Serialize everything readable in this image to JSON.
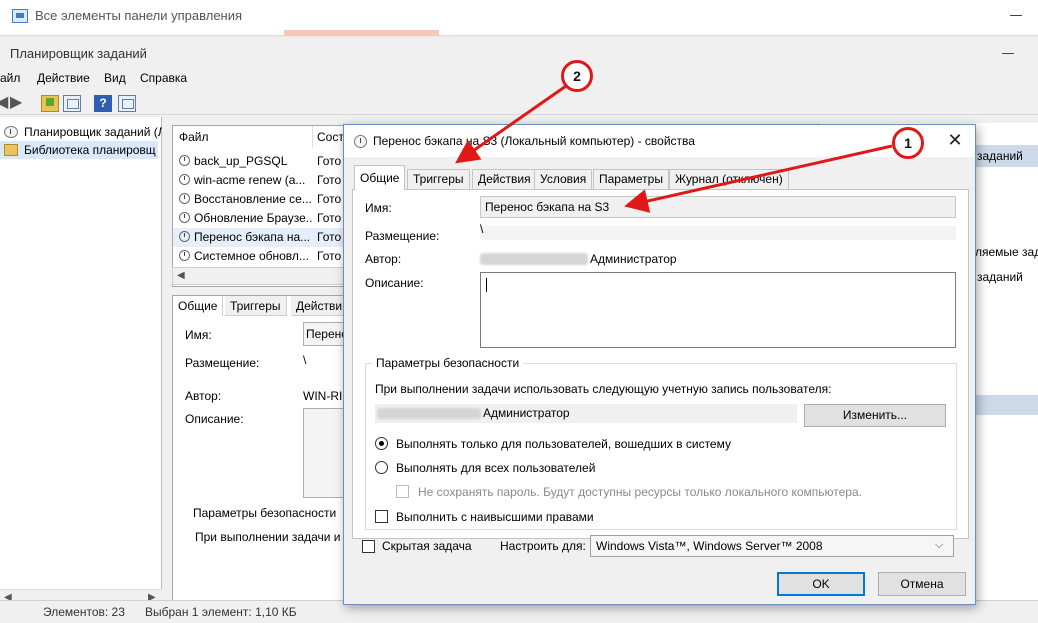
{
  "control_panel": {
    "title": "Все элементы панели управления"
  },
  "scheduler": {
    "title": "Планировщик заданий",
    "menu": [
      "айл",
      "Действие",
      "Вид",
      "Справка"
    ],
    "tree": [
      "Планировщик заданий (Лока",
      "Библиотека планировщ"
    ],
    "task_list": {
      "columns": [
        "Файл",
        "Сост"
      ],
      "rows": [
        {
          "name": "back_up_PGSQL",
          "status": "Гото"
        },
        {
          "name": "win-acme renew (a...",
          "status": "Гото"
        },
        {
          "name": "Восстановление се...",
          "status": "Гото"
        },
        {
          "name": "Обновление Браузе...",
          "status": "Гото"
        },
        {
          "name": "Перенос бэкапа на...",
          "status": "Гото"
        },
        {
          "name": "Системное обновл...",
          "status": "Гото"
        }
      ]
    },
    "detail": {
      "tabs": [
        "Общие",
        "Триггеры",
        "Действи"
      ],
      "name_label": "Имя:",
      "name_value": "Перенс",
      "location_label": "Размещение:",
      "location_value": "\\",
      "author_label": "Автор:",
      "author_value": "WIN-RI",
      "description_label": "Описание:",
      "security_label": "Параметры безопасности",
      "security_text": "При выполнении задачи и"
    },
    "actions": {
      "header": "заданий",
      "items": [
        "ляемые задания",
        "заданий"
      ]
    },
    "status": {
      "count": "Элементов: 23",
      "selected": "Выбран 1 элемент: 1,10 КБ"
    }
  },
  "dialog": {
    "title": "Перенос бэкапа на S3 (Локальный компьютер) - свойства",
    "close": "✕",
    "tabs": [
      "Общие",
      "Триггеры",
      "Действия",
      "Условия",
      "Параметры",
      "Журнал (отключен)"
    ],
    "general": {
      "name_label": "Имя:",
      "name_value": "Перенос бэкапа на S3",
      "location_label": "Размещение:",
      "location_value": "\\",
      "author_label": "Автор:",
      "author_value": "Администратор",
      "description_label": "Описание:",
      "description_value": ""
    },
    "security": {
      "title": "Параметры безопасности",
      "account_prompt": "При выполнении задачи использовать следующую учетную запись пользователя:",
      "account_value": "Администратор",
      "change_button": "Изменить...",
      "radio_logged_on": "Выполнять только для пользователей, вошедших в систему",
      "radio_all_users": "Выполнять для всех пользователей",
      "no_store_password": "Не сохранять пароль. Будут доступны ресурсы только локального компьютера.",
      "highest_privileges": "Выполнить с наивысшими правами"
    },
    "hidden_task": "Скрытая задача",
    "configure_label": "Настроить для:",
    "configure_value": "Windows Vista™, Windows Server™ 2008",
    "ok": "OK",
    "cancel": "Отмена"
  },
  "annotations": [
    "1",
    "2"
  ],
  "colors": {
    "accent": "#0078d7",
    "annotation": "#e01818",
    "selection": "#d9e8fb"
  }
}
